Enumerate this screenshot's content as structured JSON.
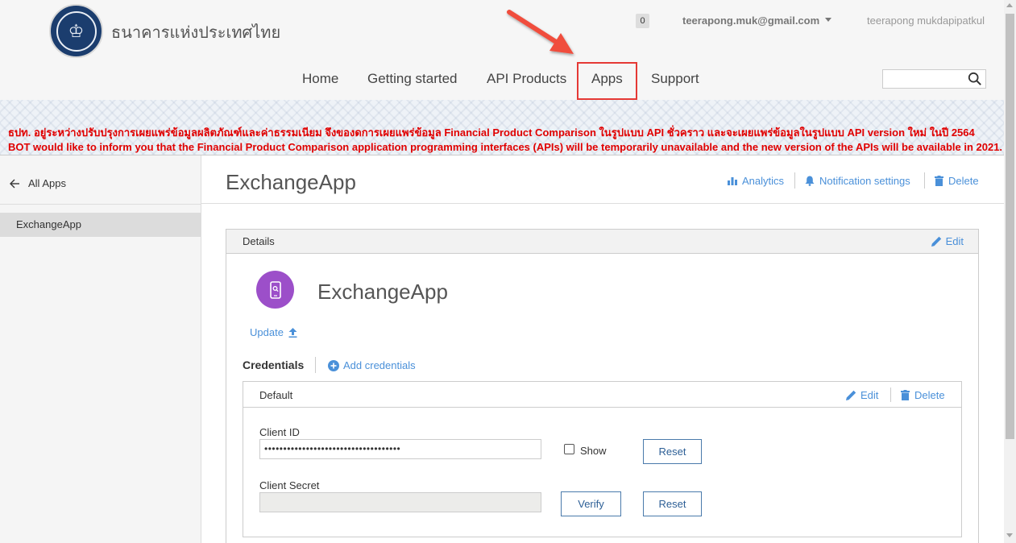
{
  "header": {
    "brand": "ธนาคารแห่งประเทศไทย",
    "notification_count": "0",
    "user_email": "teerapong.muk@gmail.com",
    "user_name": "teerapong mukdapipatkul",
    "nav": [
      "Home",
      "Getting started",
      "API Products",
      "Apps",
      "Support"
    ],
    "active_nav": "Apps",
    "search_value": "",
    "annotation_color": "#e53935"
  },
  "banner": {
    "line_th": "ธปท. อยู่ระหว่างปรับปรุงการเผยแพร่ข้อมูลผลิตภัณฑ์และค่าธรรมเนียม จึงของดการเผยแพร่ข้อมูล Financial Product Comparison ในรูปแบบ API ชั่วคราว และจะเผยแพร่ข้อมูลในรูปแบบ API version ใหม่ ในปี 2564",
    "line_en": "BOT would like to inform you that the Financial Product Comparison application programming interfaces (APIs) will be temporarily unavailable and the new version of the APIs will be available in 2021.",
    "color": "#e00000"
  },
  "sidebar": {
    "back_label": "All Apps",
    "items": [
      "ExchangeApp"
    ]
  },
  "main": {
    "title": "ExchangeApp",
    "actions": {
      "analytics": "Analytics",
      "notification_settings": "Notification settings",
      "delete": "Delete"
    },
    "details": {
      "title": "Details",
      "edit": "Edit",
      "app_name": "ExchangeApp",
      "update": "Update"
    },
    "credentials": {
      "label": "Credentials",
      "add": "Add credentials",
      "default_title": "Default",
      "edit": "Edit",
      "delete": "Delete",
      "client_id_label": "Client ID",
      "client_id_value": "••••••••••••••••••••••••••••••••••••",
      "show_label": "Show",
      "reset_label": "Reset",
      "client_secret_label": "Client Secret",
      "client_secret_value": "",
      "verify_label": "Verify",
      "reset2_label": "Reset"
    }
  },
  "colors": {
    "link": "#4a90d9",
    "app_icon": "#9c4fc9",
    "logo": "#1b3d6e"
  }
}
